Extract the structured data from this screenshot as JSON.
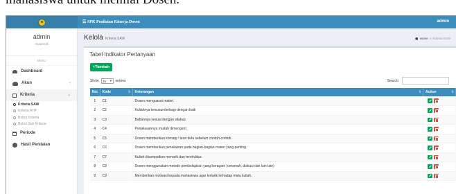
{
  "document": {
    "caption": "mahasiswa untuk menilai Dosen."
  },
  "topbar": {
    "brand": "☰ SPK Penilaian Kinerja Dosen",
    "user": "admin"
  },
  "sidebar": {
    "user_name": "admin",
    "user_role": "Akademik",
    "menu_header": "MENU",
    "items": [
      {
        "label": "Dashboard",
        "icon": "dashboard-icon"
      },
      {
        "label": "Akun",
        "icon": "users-icon",
        "caret": "‹"
      },
      {
        "label": "Kriteria",
        "icon": "edit-icon",
        "caret": "⌄"
      },
      {
        "label": "Periode",
        "icon": "calendar-icon"
      },
      {
        "label": "Hasil Penilaian",
        "icon": "pie-chart-icon"
      }
    ],
    "sub_items": [
      "Kriteria SAW",
      "Kriteria AHP",
      "Bobot Kriteria",
      "Bobot Sub Kriteria"
    ]
  },
  "content": {
    "title": "Kelola",
    "subtitle": "Kriteria SAW",
    "breadcrumb_home": "Home",
    "breadcrumb_sep": ">",
    "breadcrumb_current": "Kriteria SAW"
  },
  "box": {
    "title": "Tabel Indikator Pertanyaan",
    "add_button": "+Tambah",
    "show_label": "Show",
    "show_value": "25",
    "entries_label": "entries",
    "search_label": "Search:"
  },
  "table": {
    "headers": [
      "No",
      "Kode",
      "Keterangan",
      "Action"
    ],
    "rows": [
      {
        "no": "1",
        "kode": "C1",
        "ket": "Dosen menguasai materi."
      },
      {
        "no": "2",
        "kode": "C2",
        "ket": "Kuliahnya tersusun/terbagi dengan baik"
      },
      {
        "no": "3",
        "kode": "C3",
        "ket": "Bahannya sesuai dengan silabus"
      },
      {
        "no": "4",
        "kode": "C4",
        "ket": "Penjelasannya mudah dimengerti"
      },
      {
        "no": "5",
        "kode": "C5",
        "ket": "Dosen memberikan konsep / teori dulu sebelum contoh-contoh."
      },
      {
        "no": "6",
        "kode": "C6",
        "ket": "Dosen memberikan penekanan pada bagian-bagian materi yang penting."
      },
      {
        "no": "7",
        "kode": "C7",
        "ket": "Kuliah disampaikan menarik dan terstruktur."
      },
      {
        "no": "8",
        "kode": "C8",
        "ket": "Dosen menggunakan metode pembelajaran yang beragam (ceramah, diskusi dan lain-lain)"
      },
      {
        "no": "9",
        "kode": "C9",
        "ket": "Memberikan motivasi kepada mahasiswa agar tertarik terhadap mata kuliah."
      }
    ]
  },
  "colors": {
    "primary": "#3c8dbc",
    "success": "#00a65a",
    "danger": "#dd4b39",
    "content_bg": "#ecf0f5"
  }
}
